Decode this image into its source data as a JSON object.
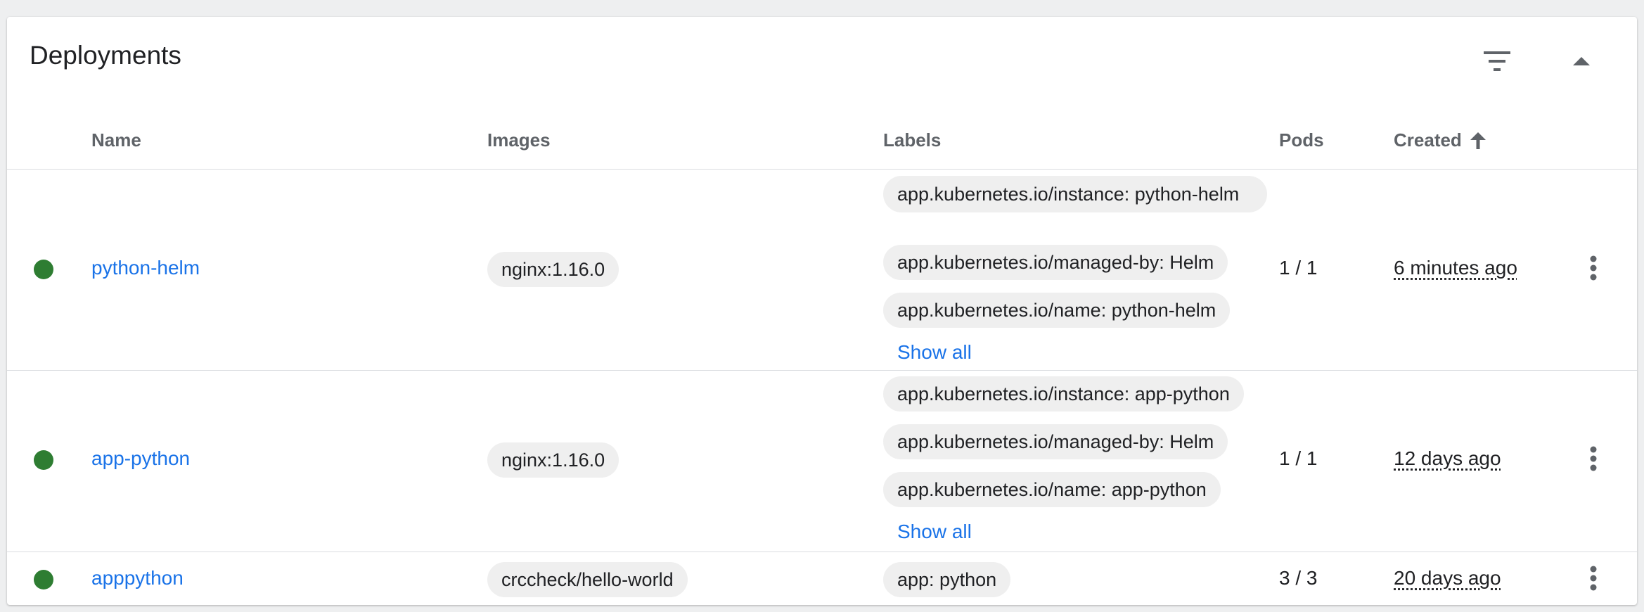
{
  "card": {
    "title": "Deployments",
    "icons": {
      "filter": "filter-icon",
      "collapse": "arrow-up-icon"
    }
  },
  "columns": {
    "name": "Name",
    "images": "Images",
    "labels": "Labels",
    "pods": "Pods",
    "created": "Created"
  },
  "sort": {
    "column": "created",
    "direction": "ascending",
    "icon": "arrow-up-icon"
  },
  "rows": [
    {
      "status": "running",
      "name": "python-helm",
      "image": "nginx:1.16.0",
      "labels": [
        "app.kubernetes.io/instance: python-helm",
        "app.kubernetes.io/managed-by: Helm",
        "app.kubernetes.io/name: python-helm"
      ],
      "show_all": "Show all",
      "pods": "1 / 1",
      "created": "6 minutes ago"
    },
    {
      "status": "running",
      "name": "app-python",
      "image": "nginx:1.16.0",
      "labels": [
        "app.kubernetes.io/instance: app-python",
        "app.kubernetes.io/managed-by: Helm",
        "app.kubernetes.io/name: app-python"
      ],
      "show_all": "Show all",
      "pods": "1 / 1",
      "created": "12 days ago"
    },
    {
      "status": "running",
      "name": "apppython",
      "image": "crccheck/hello-world",
      "labels": [
        "app: python"
      ],
      "pods": "3 / 3",
      "created": "20 days ago"
    }
  ],
  "colors": {
    "status_ok": "#2e7d32",
    "link": "#1a73e8",
    "chip_bg": "#efefef",
    "header_text": "#5f6368"
  }
}
